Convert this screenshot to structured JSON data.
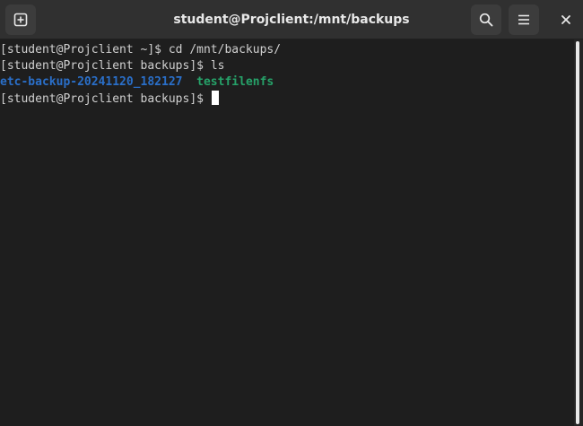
{
  "window": {
    "title": "student@Projclient:/mnt/backups"
  },
  "headerbar": {
    "icons": {
      "new_tab": "new-tab-icon",
      "search": "search-icon",
      "menu": "hamburger-menu-icon",
      "close": "close-icon"
    }
  },
  "terminal": {
    "lines": [
      {
        "prompt": "[student@Projclient ~]$ ",
        "command": "cd /mnt/backups/"
      },
      {
        "prompt": "[student@Projclient backups]$ ",
        "command": "ls"
      },
      {
        "entries": [
          {
            "name": "etc-backup-20241120_182127",
            "color": "#2a6fc9"
          },
          {
            "name": "testfilenfs",
            "color": "#26a269"
          }
        ]
      },
      {
        "prompt": "[student@Projclient backups]$ ",
        "command": ""
      }
    ]
  },
  "colors": {
    "background": "#1e1e1e",
    "headerbar": "#303030",
    "text": "#d0d0d0",
    "directory_blue": "#2a6fc9",
    "directory_green": "#26a269"
  }
}
